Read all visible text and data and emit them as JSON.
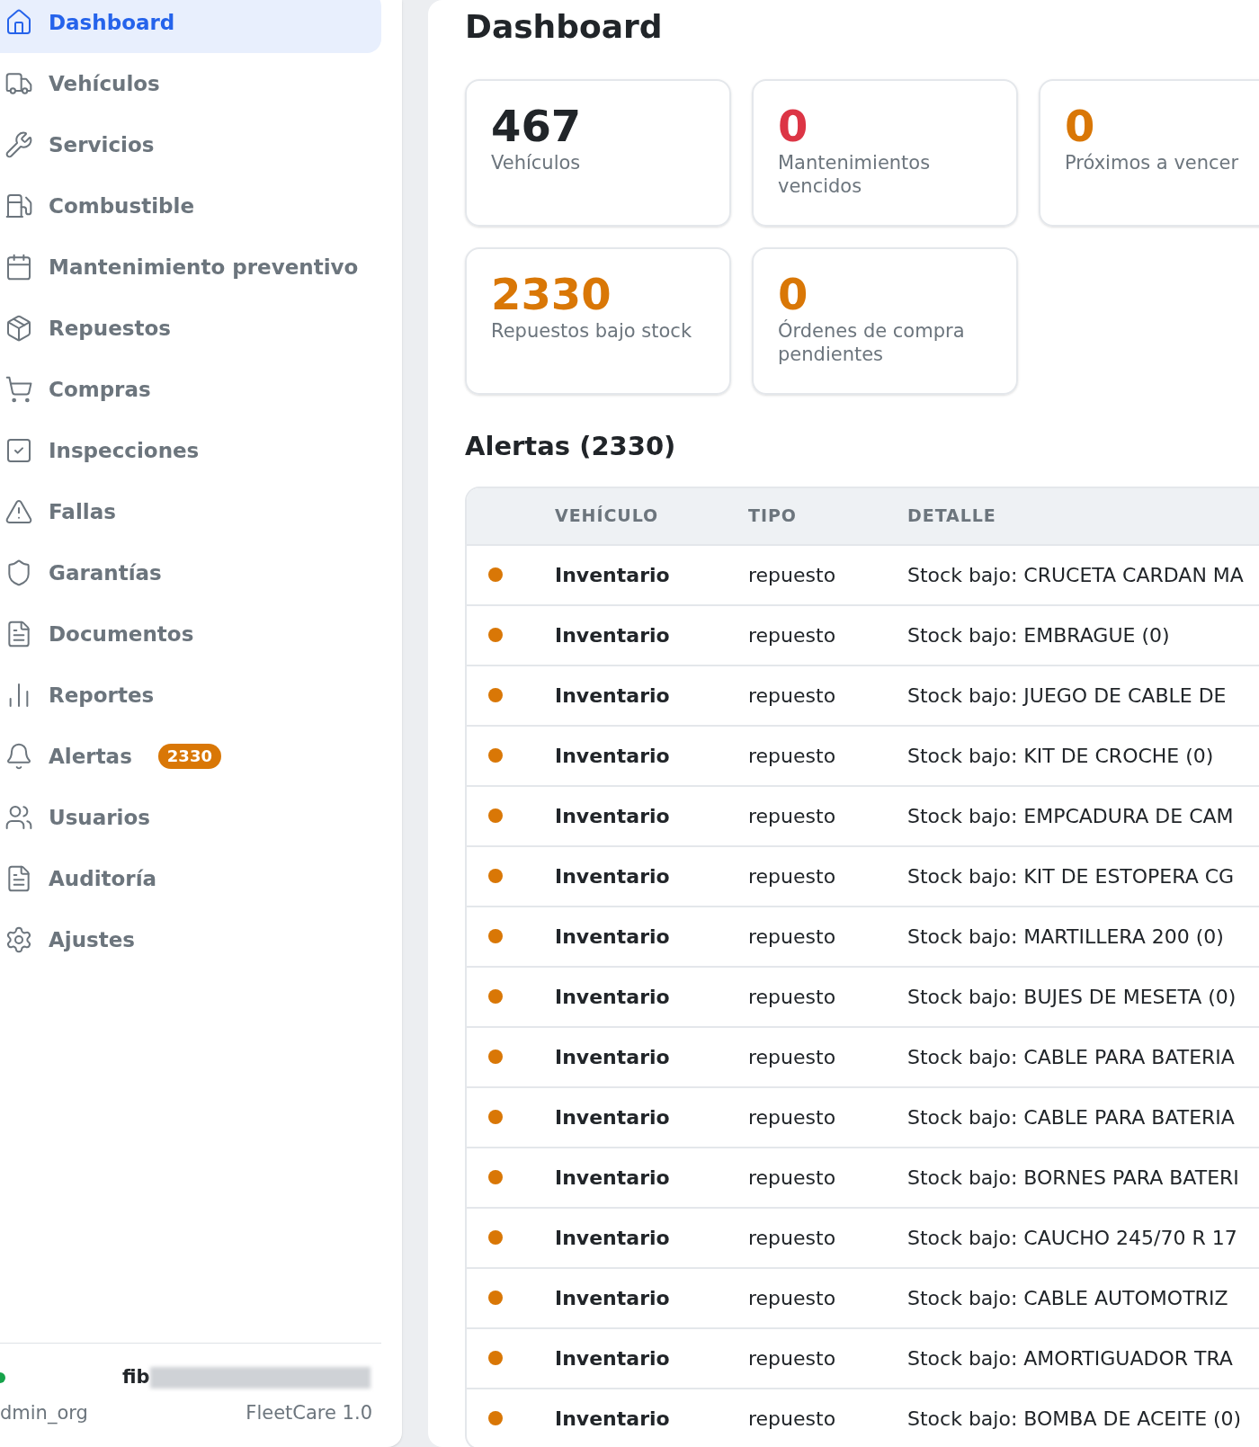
{
  "sidebar": {
    "items": [
      {
        "label": "Dashboard",
        "selected": true
      },
      {
        "label": "Vehículos",
        "selected": false
      },
      {
        "label": "Servicios",
        "selected": false
      },
      {
        "label": "Combustible",
        "selected": false
      },
      {
        "label": "Mantenimiento preventivo",
        "selected": false
      },
      {
        "label": "Repuestos",
        "selected": false
      },
      {
        "label": "Compras",
        "selected": false
      },
      {
        "label": "Inspecciones",
        "selected": false
      },
      {
        "label": "Fallas",
        "selected": false
      },
      {
        "label": "Garantías",
        "selected": false
      },
      {
        "label": "Documentos",
        "selected": false
      },
      {
        "label": "Reportes",
        "selected": false
      },
      {
        "label": "Alertas",
        "selected": false,
        "badge": "2330"
      },
      {
        "label": "Usuarios",
        "selected": false
      },
      {
        "label": "Auditoría",
        "selected": false
      },
      {
        "label": "Ajustes",
        "selected": false
      }
    ],
    "footer": {
      "user_name": "fib",
      "role": "dmin_org",
      "version": "FleetCare 1.0"
    }
  },
  "main": {
    "title": "Dashboard",
    "stats": [
      {
        "value": "467",
        "label": "Vehículos",
        "color": "#212529"
      },
      {
        "value": "0",
        "label": "Mantenimientos vencidos",
        "color": "#dc3545"
      },
      {
        "value": "0",
        "label": "Próximos a vencer",
        "color": "#d97706"
      },
      {
        "value": "2330",
        "label": "Repuestos bajo stock",
        "color": "#d97706"
      },
      {
        "value": "0",
        "label": "Órdenes de compra pendientes",
        "color": "#d97706"
      }
    ],
    "alerts_title": "Alertas (2330)",
    "table": {
      "columns": [
        "VEHÍCULO",
        "TIPO",
        "DETALLE"
      ],
      "rows": [
        {
          "color": "#d97706",
          "vehicle": "Inventario",
          "type": "repuesto",
          "detail": "Stock bajo: CRUCETA CARDAN MA"
        },
        {
          "color": "#d97706",
          "vehicle": "Inventario",
          "type": "repuesto",
          "detail": "Stock bajo: EMBRAGUE (0)"
        },
        {
          "color": "#d97706",
          "vehicle": "Inventario",
          "type": "repuesto",
          "detail": "Stock bajo: JUEGO DE CABLE DE"
        },
        {
          "color": "#d97706",
          "vehicle": "Inventario",
          "type": "repuesto",
          "detail": "Stock bajo: KIT DE CROCHE (0)"
        },
        {
          "color": "#d97706",
          "vehicle": "Inventario",
          "type": "repuesto",
          "detail": "Stock bajo: EMPCADURA DE CAM"
        },
        {
          "color": "#d97706",
          "vehicle": "Inventario",
          "type": "repuesto",
          "detail": "Stock bajo: KIT DE ESTOPERA CG"
        },
        {
          "color": "#d97706",
          "vehicle": "Inventario",
          "type": "repuesto",
          "detail": "Stock bajo: MARTILLERA 200 (0)"
        },
        {
          "color": "#d97706",
          "vehicle": "Inventario",
          "type": "repuesto",
          "detail": "Stock bajo: BUJES DE MESETA (0)"
        },
        {
          "color": "#d97706",
          "vehicle": "Inventario",
          "type": "repuesto",
          "detail": "Stock bajo: CABLE PARA BATERIA"
        },
        {
          "color": "#d97706",
          "vehicle": "Inventario",
          "type": "repuesto",
          "detail": "Stock bajo: CABLE PARA BATERIA"
        },
        {
          "color": "#d97706",
          "vehicle": "Inventario",
          "type": "repuesto",
          "detail": "Stock bajo: BORNES PARA BATERI"
        },
        {
          "color": "#d97706",
          "vehicle": "Inventario",
          "type": "repuesto",
          "detail": "Stock bajo: CAUCHO 245/70 R 17"
        },
        {
          "color": "#d97706",
          "vehicle": "Inventario",
          "type": "repuesto",
          "detail": "Stock bajo: CABLE AUTOMOTRIZ"
        },
        {
          "color": "#d97706",
          "vehicle": "Inventario",
          "type": "repuesto",
          "detail": "Stock bajo: AMORTIGUADOR TRA"
        },
        {
          "color": "#d97706",
          "vehicle": "Inventario",
          "type": "repuesto",
          "detail": "Stock bajo: BOMBA DE ACEITE (0)"
        }
      ]
    }
  }
}
